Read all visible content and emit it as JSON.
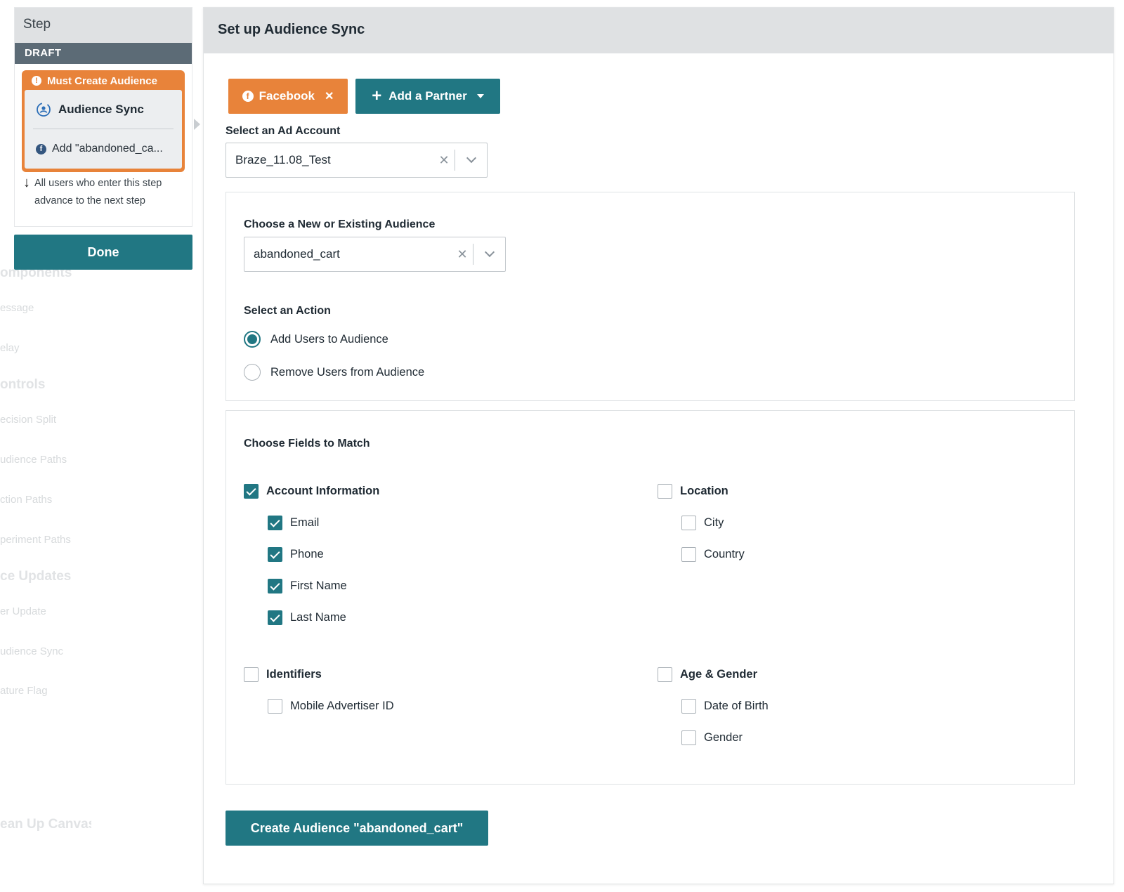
{
  "background": {
    "items": [
      {
        "text": "omponents",
        "heading": true
      },
      {
        "text": "essage",
        "heading": false
      },
      {
        "text": "elay",
        "heading": false
      },
      {
        "text": "ontrols",
        "heading": true
      },
      {
        "text": "ecision Split",
        "heading": false
      },
      {
        "text": "udience Paths",
        "heading": false
      },
      {
        "text": "ction Paths",
        "heading": false
      },
      {
        "text": "periment Paths",
        "heading": false
      },
      {
        "text": "ce Updates",
        "heading": true
      },
      {
        "text": "er Update",
        "heading": false
      },
      {
        "text": "udience Sync",
        "heading": false
      },
      {
        "text": "ature Flag",
        "heading": false
      },
      {
        "text": "ean Up Canvas",
        "heading": true
      }
    ]
  },
  "step_panel": {
    "title": "Step",
    "status": "DRAFT",
    "warning": "Must Create Audience",
    "step_name": "Audience Sync",
    "step_action": "Add \"abandoned_ca...",
    "note": "All users who enter this step advance to the next step",
    "done_label": "Done"
  },
  "main": {
    "title": "Set up Audience Sync",
    "partner_label": "Facebook",
    "add_partner_label": "Add a Partner",
    "ad_account_label": "Select an Ad Account",
    "ad_account_value": "Braze_11.08_Test",
    "audience_label": "Choose a New or Existing Audience",
    "audience_value": "abandoned_cart",
    "action_label": "Select an Action",
    "actions": [
      {
        "label": "Add Users to Audience",
        "selected": true
      },
      {
        "label": "Remove Users from Audience",
        "selected": false
      }
    ],
    "fields_label": "Choose Fields to Match",
    "field_groups": {
      "account": {
        "label": "Account Information",
        "checked": true,
        "fields": [
          {
            "label": "Email",
            "checked": true
          },
          {
            "label": "Phone",
            "checked": true
          },
          {
            "label": "First Name",
            "checked": true
          },
          {
            "label": "Last Name",
            "checked": true
          }
        ]
      },
      "location": {
        "label": "Location",
        "checked": false,
        "fields": [
          {
            "label": "City",
            "checked": false
          },
          {
            "label": "Country",
            "checked": false
          }
        ]
      },
      "identifiers": {
        "label": "Identifiers",
        "checked": false,
        "fields": [
          {
            "label": "Mobile Advertiser ID",
            "checked": false
          }
        ]
      },
      "age_gender": {
        "label": "Age & Gender",
        "checked": false,
        "fields": [
          {
            "label": "Date of Birth",
            "checked": false
          },
          {
            "label": "Gender",
            "checked": false
          }
        ]
      }
    },
    "create_label": "Create Audience \"abandoned_cart\""
  },
  "colors": {
    "accent": "#217783",
    "partner": "#e8833a",
    "header_bg": "#dfe1e3",
    "draft_bg": "#5c6b76"
  }
}
